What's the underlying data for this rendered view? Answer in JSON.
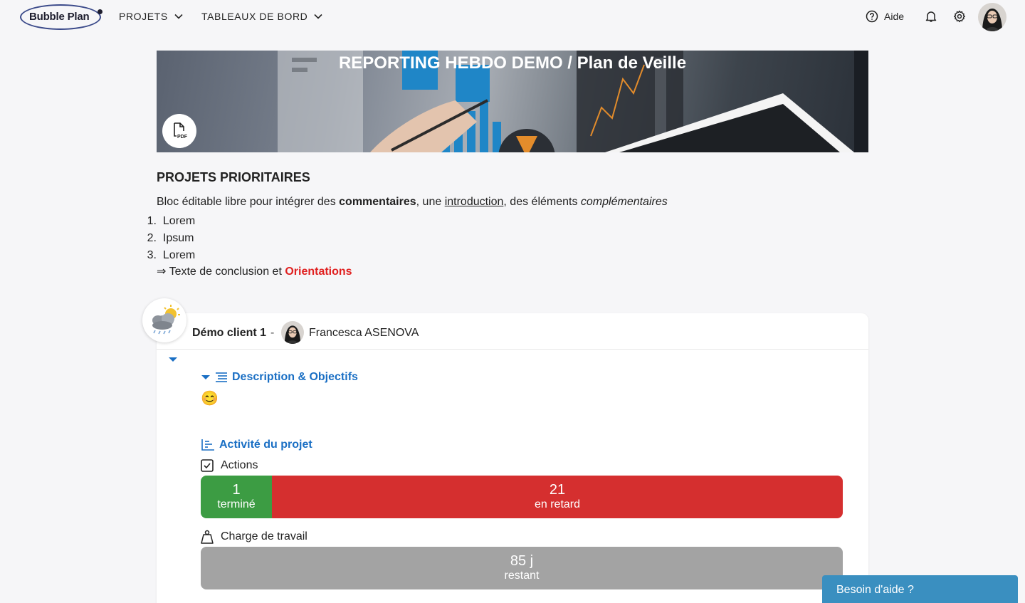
{
  "nav": {
    "logo_text": "Bubble Plan",
    "menus": [
      "PROJETS",
      "TABLEAUX DE BORD"
    ],
    "help_label": "Aide"
  },
  "banner": {
    "title": "REPORTING HEBDO DEMO / Plan de Veille",
    "pdf_label": "PDF"
  },
  "editor": {
    "section_title": "PROJETS PRIORITAIRES",
    "intro": {
      "t1": "Bloc éditable libre pour intégrer des ",
      "bold": "commentaires",
      "t2": ", une ",
      "underline": "introduction",
      "t3": ", des éléments ",
      "italic": "complémentaires"
    },
    "list": [
      {
        "num": "1.",
        "text": "Lorem"
      },
      {
        "num": "2.",
        "text": "Ipsum"
      },
      {
        "num": "3.",
        "text": "Lorem"
      }
    ],
    "conclusion": {
      "text": "⇒ Texte de conclusion et ",
      "highlight": "Orientations"
    }
  },
  "project": {
    "client": "Démo client 1",
    "separator": "-",
    "owner": "Francesca ASENOVA",
    "description_title": "Description & Objectifs",
    "description_emoji": "😊",
    "activity_title": "Activité du projet",
    "actions": {
      "label": "Actions",
      "done": {
        "count": "1",
        "label": "terminé",
        "value": 1
      },
      "late": {
        "count": "21",
        "label": "en retard",
        "value": 21
      }
    },
    "workload": {
      "label": "Charge de travail",
      "value": "85 j",
      "sub": "restant"
    }
  },
  "help_chat": "Besoin d'aide ?",
  "colors": {
    "accent": "#1a6fc4",
    "done": "#3c9c43",
    "late": "#d52f2f",
    "workload": "#a3a3a3",
    "chat": "#3a8fc0",
    "highlight": "#e02020"
  }
}
